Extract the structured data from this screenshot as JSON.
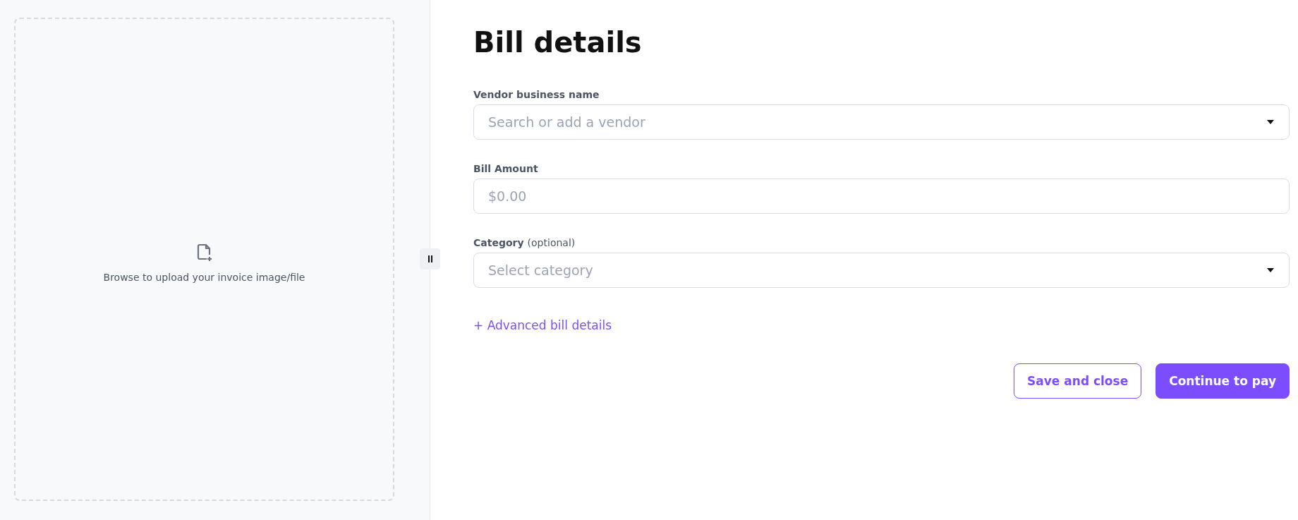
{
  "upload": {
    "text": "Browse to upload your invoice image/file"
  },
  "title": "Bill details",
  "fields": [
    {
      "label": "Vendor business name",
      "placeholder": "Search or add a vendor",
      "kind": "select"
    },
    {
      "label": "Bill Amount",
      "placeholder": "$0.00",
      "kind": "text"
    },
    {
      "label": "Category",
      "note": "(optional)",
      "placeholder": "Select category",
      "kind": "select"
    }
  ],
  "advanced_link": "+ Advanced bill details",
  "buttons": [
    {
      "label": "Save and close",
      "kind": "secondary"
    },
    {
      "label": "Continue to pay",
      "kind": "primary"
    }
  ]
}
